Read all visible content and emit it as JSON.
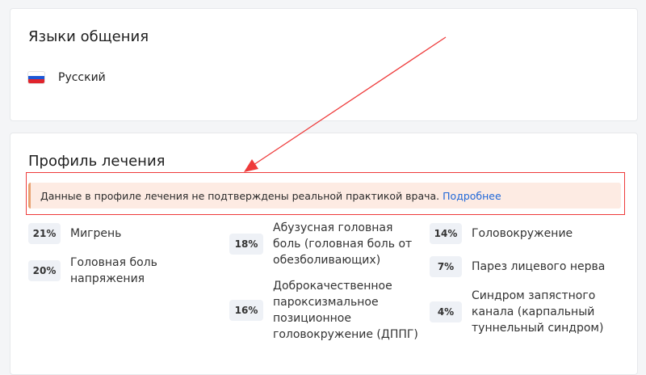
{
  "languages": {
    "title": "Языки общения",
    "items": [
      {
        "label": "Русский",
        "flag": "russian-flag-icon"
      }
    ]
  },
  "profile": {
    "title": "Профиль лечения",
    "alert": {
      "text": "Данные в профиле лечения не подтверждены реальной практикой врача.",
      "link": "Подробнее"
    },
    "conditions": [
      {
        "percent": "21%",
        "label": "Мигрень"
      },
      {
        "percent": "20%",
        "label": "Головная боль напряжения"
      },
      {
        "percent": "18%",
        "label": "Абузусная головная боль (головная боль от обезболивающих)"
      },
      {
        "percent": "16%",
        "label": "Доброкачественное пароксизмальное позиционное головокружение (ДППГ)"
      },
      {
        "percent": "14%",
        "label": "Головокружение"
      },
      {
        "percent": "7%",
        "label": "Парез лицевого нерва"
      },
      {
        "percent": "4%",
        "label": "Синдром запястного канала (карпальный туннельный синдром)"
      }
    ]
  },
  "colors": {
    "annotation": "#ee3b3b",
    "alert_bg": "#fdebe3",
    "alert_border": "#e8a271",
    "link": "#1f67d8",
    "pill_bg": "#eef1f6"
  }
}
